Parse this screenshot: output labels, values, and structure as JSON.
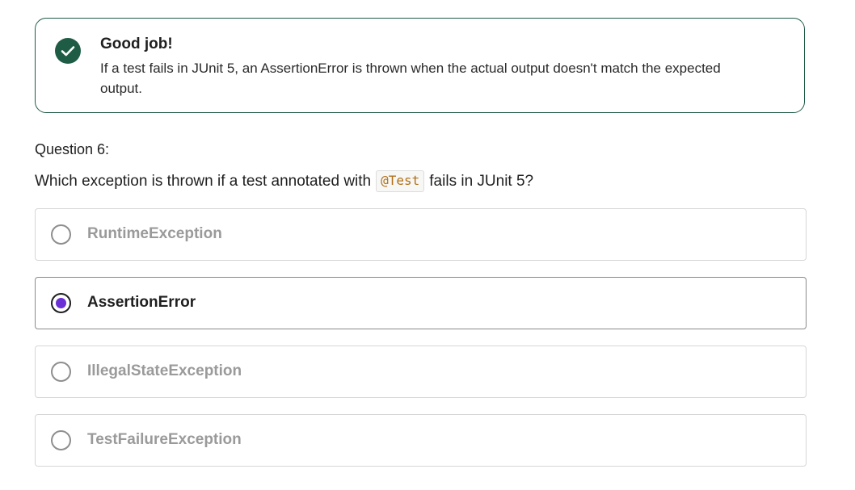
{
  "feedback": {
    "title": "Good job!",
    "text": "If a test fails in JUnit 5, an AssertionError is thrown when the actual output doesn't match the expected output.",
    "icon": "check-icon",
    "accent_color": "#1f5c45"
  },
  "question": {
    "label": "Question 6:",
    "text_before": "Which exception is thrown if a test annotated with",
    "code": "@Test",
    "text_after": "fails in JUnit 5?"
  },
  "options": [
    {
      "label": "RuntimeException",
      "selected": false
    },
    {
      "label": "AssertionError",
      "selected": true
    },
    {
      "label": "IllegalStateException",
      "selected": false
    },
    {
      "label": "TestFailureException",
      "selected": false
    }
  ],
  "colors": {
    "selected_radio": "#6b2fd6",
    "unselected_text": "#9a9a9a"
  }
}
